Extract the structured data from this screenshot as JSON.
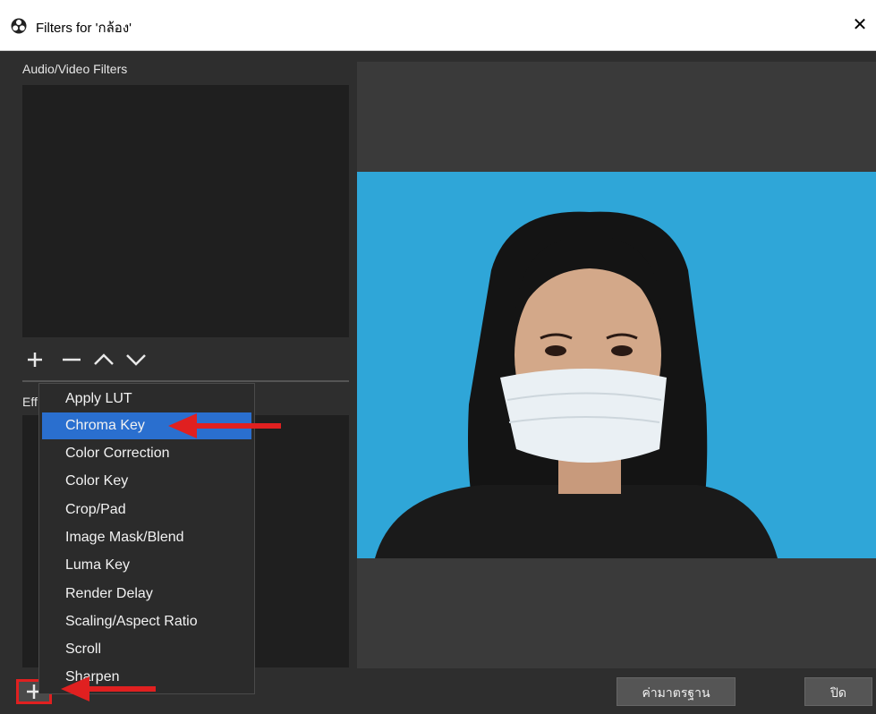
{
  "window": {
    "title": "Filters for 'กล้อง'",
    "close_glyph": "✕"
  },
  "left": {
    "av_filters_label": "Audio/Video Filters",
    "effect_label": "Eff"
  },
  "toolbar": {
    "add_icon": "plus-icon",
    "remove_icon": "minus-icon",
    "up_icon": "chevron-up-icon",
    "down_icon": "chevron-down-icon"
  },
  "menu": {
    "items": [
      {
        "label": "Apply LUT"
      },
      {
        "label": "Chroma Key",
        "selected": true
      },
      {
        "label": "Color Correction"
      },
      {
        "label": "Color Key"
      },
      {
        "label": "Crop/Pad"
      },
      {
        "label": "Image Mask/Blend"
      },
      {
        "label": "Luma Key"
      },
      {
        "label": "Render Delay"
      },
      {
        "label": "Scaling/Aspect Ratio"
      },
      {
        "label": "Scroll"
      },
      {
        "label": "Sharpen"
      }
    ]
  },
  "buttons": {
    "defaults": "ค่ามาตรฐาน",
    "close": "ปิด"
  },
  "colors": {
    "accent": "#2a6fcf",
    "highlight_arrow": "#e02020",
    "preview_bg": "#2fa6d8"
  }
}
